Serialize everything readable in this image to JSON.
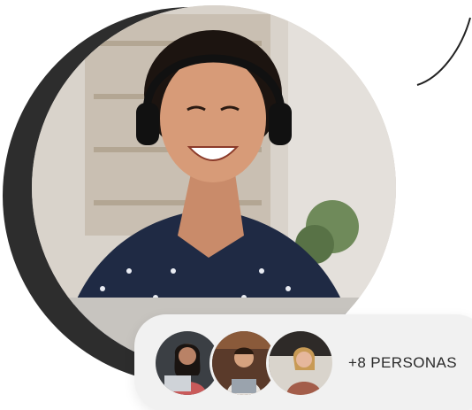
{
  "participants": {
    "more_label": "+8 PERSONAS"
  },
  "colors": {
    "crescent": "#2d2d2d",
    "pill_background": "#f1f1f1",
    "text": "#2a2a2a"
  },
  "icons": {
    "decor_curve": "curved-line",
    "main_photo": "woman-with-headset-laughing",
    "avatar_1": "woman-with-laptop",
    "avatar_2": "man-at-desk",
    "avatar_3": "woman-in-office"
  }
}
